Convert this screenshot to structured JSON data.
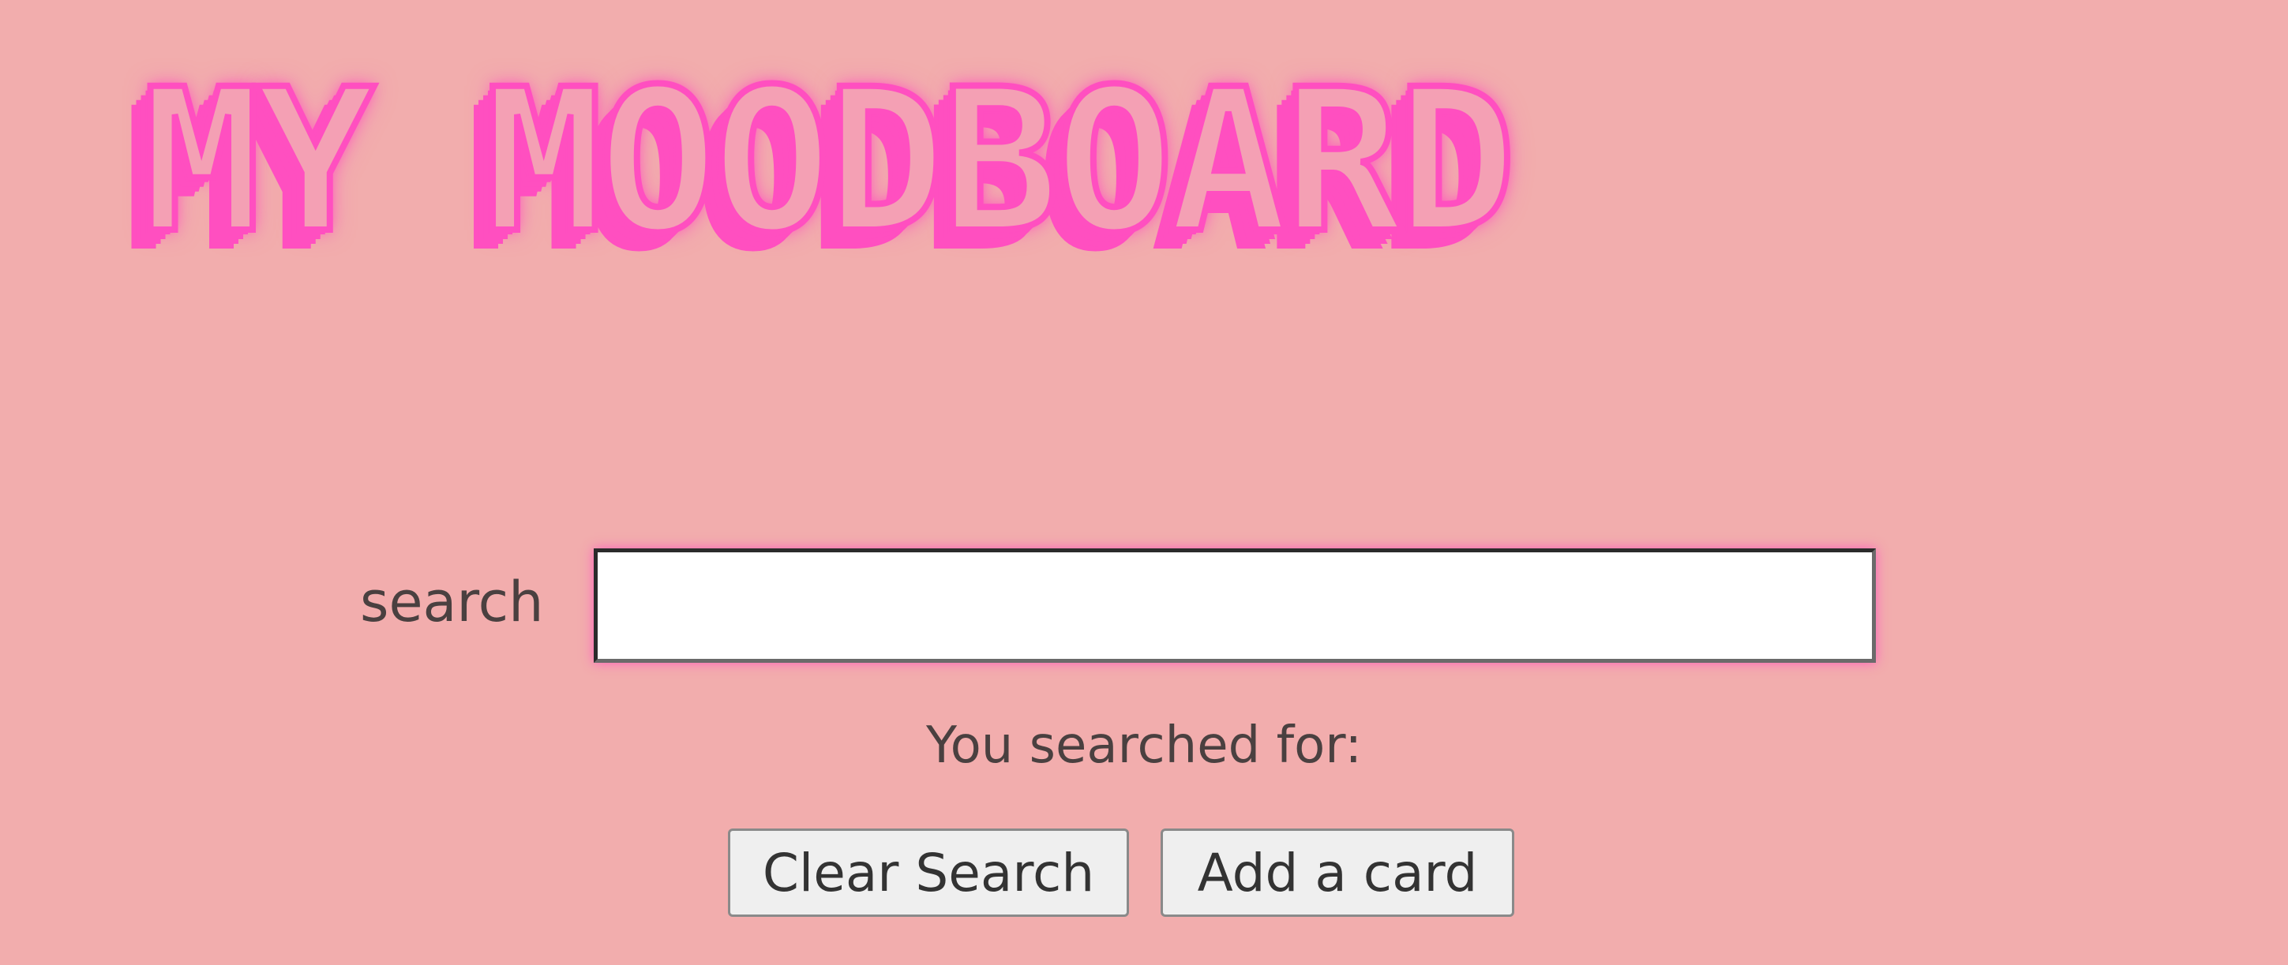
{
  "header": {
    "title": "MY MOODBOARD"
  },
  "search": {
    "label": "search",
    "value": "",
    "placeholder": "",
    "result_text": "You searched for:"
  },
  "buttons": {
    "clear_label": "Clear Search",
    "add_label": "Add a card"
  },
  "colors": {
    "background": "#f2adad",
    "title_accent": "#ff4fc0"
  }
}
